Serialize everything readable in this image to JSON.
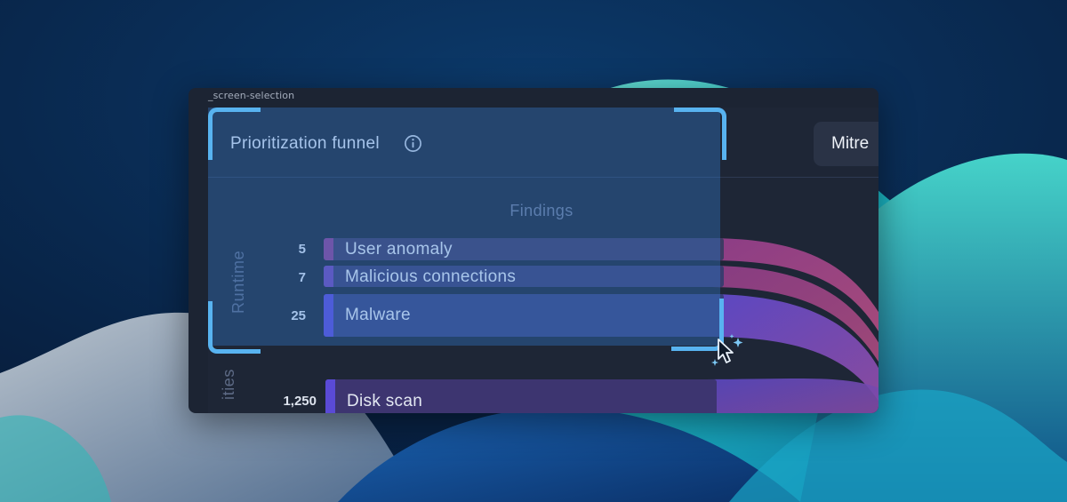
{
  "window": {
    "title": "_screen-selection"
  },
  "panel": {
    "title": "Prioritization funnel",
    "info_icon": "info-circle-icon",
    "mitre_button": "Mitre"
  },
  "findings": {
    "title": "Findings",
    "groups": [
      {
        "label": "Runtime",
        "rows": [
          {
            "count": "5",
            "label": "User anomaly",
            "color": "#8a3f8f"
          },
          {
            "count": "7",
            "label": "Malicious connections",
            "color": "#6f47b5"
          },
          {
            "count": "25",
            "label": "Malware",
            "color": "#5a4ad6"
          }
        ]
      },
      {
        "label": "ities",
        "rows": [
          {
            "count": "1,250",
            "label": "Disk scan",
            "color": "#5a4ad6"
          }
        ]
      }
    ]
  },
  "selection": {
    "color": "#58b3f0",
    "cursor_icon": "sparkle-cursor-icon"
  },
  "colors": {
    "bg_dark": "#0a2a4e",
    "hill_teal": "#1fc7c9",
    "panel": "#1e2636",
    "flow_pink": "#9a4480"
  }
}
